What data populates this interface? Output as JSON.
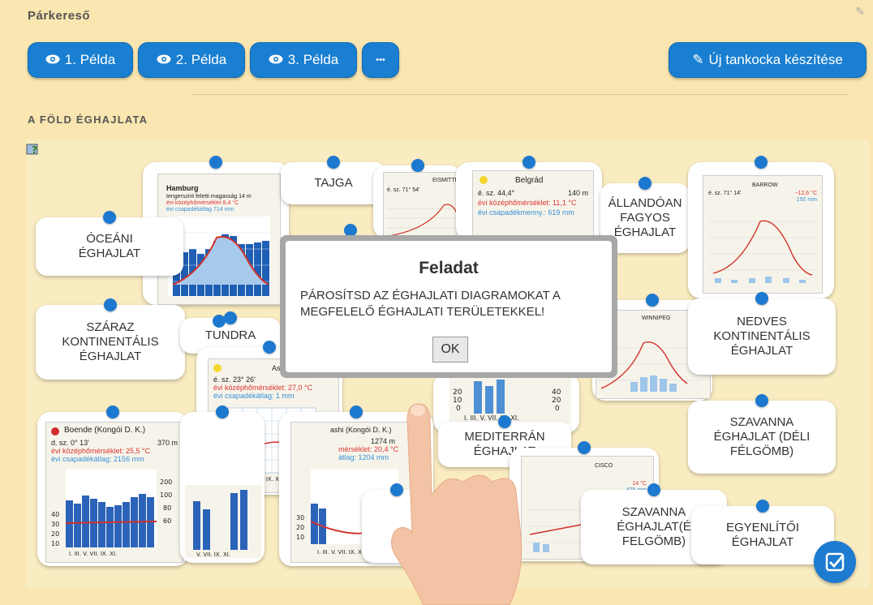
{
  "app_title": "Párkereső",
  "toolbar": {
    "example1": "1. Példa",
    "example2": "2. Példa",
    "example3": "3. Példa",
    "more": "•••",
    "create": "Új tankocka készítése"
  },
  "section_title": "A FÖLD ÉGHAJLATA",
  "labels": {
    "oceani": "ÓCEÁNI ÉGHAJLAT",
    "tajga": "TAJGA",
    "allandoan": "ÁLLANDÓAN FAGYOS ÉGHAJLAT",
    "szaraz": "SZÁRAZ KONTINENTÁLIS ÉGHAJLAT",
    "tundra": "TUNDRA",
    "nedves": "NEDVES KONTINENTÁLIS ÉGHAJLAT",
    "mediterran": "MEDITERRÁN ÉGHAJLAT",
    "szavanna_deli": "SZAVANNA ÉGHAJLAT (DÉLI FÉLGÖMB)",
    "szavanna_eszaki": "SZAVANNA ÉGHAJLAT(É FELGÖMB)",
    "egyenlitoi": "EGYENLÍTŐI ÉGHAJLAT"
  },
  "diagrams": {
    "hamburg": {
      "city": "Hamburg",
      "l1": "tengerszint feletti magasság  14 m",
      "l2": "évi középhőmérséklet  8,4 °C",
      "l3": "évi csapadékátlag  714 mm"
    },
    "eismitte": {
      "city": "EISMITTE",
      "l1": "é. sz. 71° 54'"
    },
    "belgrad": {
      "city": "Belgrád",
      "l1": "é. sz. 44,4°",
      "l1b": "140 m",
      "l2": "évi középhőmérséklet:  11,1 °C",
      "l3": "évi csapadékmenny.:  619 mm"
    },
    "barrow": {
      "city": "BARROW",
      "l1": "é. sz. 71° 14'",
      "l2": "−12,6 °C",
      "l3": "150 mm"
    },
    "winnipeg": {
      "city": "WINNIPEG"
    },
    "asszuan": {
      "city": "Asszuán",
      "l1": "é. sz. 23° 26'",
      "l2": "évi középhőmérséklet:  27,0 °C",
      "l3": "évi csapadékátlag:  1 mm"
    },
    "boende": {
      "city": "Boende (Kongói D. K.)",
      "l1": "d. sz. 0° 13'",
      "l1b": "370 m",
      "l2": "évi középhőmérséklet:  25,5 °C",
      "l3": "évi csapadékátlag:  2156 mm"
    },
    "lubumbashi": {
      "city": "ashi (Kongói D. K.)",
      "l1b": "1274 m",
      "l2": "mérséklet:  20,4 °C",
      "l3": "átlag:  1204 mm"
    },
    "sanfrancisco": {
      "city": "CISCO",
      "l2": "14 °C",
      "l3": "475 mm"
    }
  },
  "modal": {
    "title": "Feladat",
    "text": "PÁROSÍTSD AZ ÉGHAJLATI DIAGRAMOKAT A MEGFELELŐ ÉGHAJLATI TERÜLETEKKEL!",
    "ok": "OK"
  }
}
